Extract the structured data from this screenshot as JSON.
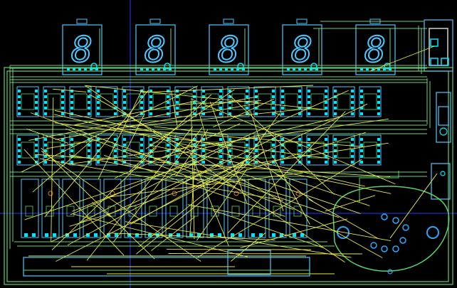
{
  "editor": {
    "view": "pcb-layout",
    "board": {
      "digit_count": 5,
      "digit_symbol": "8",
      "relay_rows": 2,
      "relays_per_row": 14,
      "transistor_footprint": "TO-3"
    }
  },
  "colors": {
    "background": "#000000",
    "copper_trace": "#6bd07a",
    "silkscreen": "#4ec9ff",
    "pad": "#00e5ff",
    "ratsnest": "#e6e84a",
    "grid_axis": "#1f3cff",
    "pad_ring": "#2aa8ff",
    "outline": "#5ad26a",
    "accent_pad": "#d07a2a"
  },
  "icons": [
    "seven-segment-display-icon",
    "transistor-footprint-icon",
    "relay-footprint-icon"
  ]
}
